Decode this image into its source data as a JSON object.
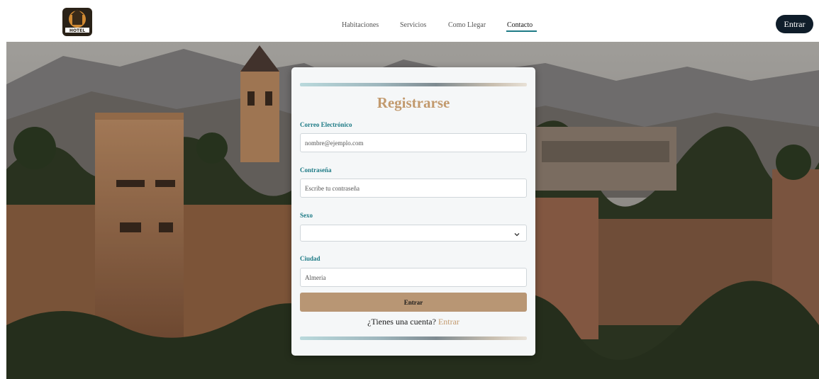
{
  "header": {
    "logo_icon": "hotel-logo-icon",
    "logo_text": "HOTEL",
    "nav": [
      "Habitaciones",
      "Servicios",
      "Como Llegar",
      "Contacto"
    ],
    "active_nav": "Contacto",
    "login_button": "Entrar"
  },
  "hero": {
    "image": "alhambra-photo"
  },
  "form": {
    "title": "Registrarse",
    "email_label": "Correo Electrónico",
    "email_placeholder": "nombre@ejemplo.com",
    "password_label": "Contraseña",
    "password_placeholder": "Escribe tu contraseña",
    "sex_label": "Sexo",
    "sex_value": "",
    "city_label": "Ciudad",
    "city_value": "Almeria",
    "submit_label": "Entrar",
    "footer_question": "¿Tienes una cuenta?",
    "footer_link": "Entrar"
  },
  "colors": {
    "accent": "#c29a6e",
    "label": "#1e7b86",
    "button": "#b89674",
    "nav_button": "#0f1d2a"
  }
}
